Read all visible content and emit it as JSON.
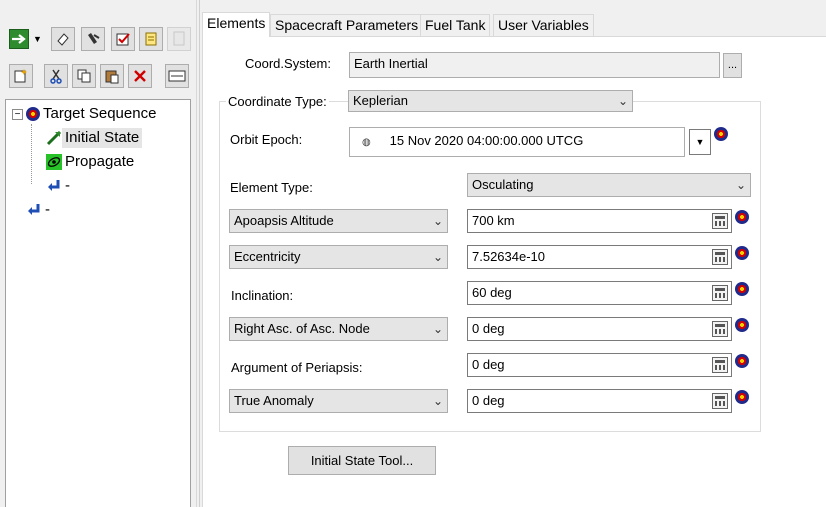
{
  "tree": {
    "items": [
      {
        "label": "Target Sequence",
        "icon": "target-sequence-icon"
      },
      {
        "label": "Initial State",
        "icon": "initial-state-icon"
      },
      {
        "label": "Propagate",
        "icon": "propagate-icon"
      },
      {
        "label": "-",
        "icon": "return-arrow-icon"
      },
      {
        "label": "-",
        "icon": "return-arrow-icon"
      }
    ]
  },
  "tabs": [
    "Elements",
    "Spacecraft Parameters",
    "Fuel Tank",
    "User Variables"
  ],
  "coord_system": {
    "label": "Coord.System:",
    "value": "Earth Inertial",
    "browse_label": "..."
  },
  "coordinate_type": {
    "label": "Coordinate Type:",
    "value": "Keplerian"
  },
  "orbit_epoch": {
    "label": "Orbit Epoch:",
    "value": "15 Nov 2020 04:00:00.000 UTCG"
  },
  "element_type": {
    "label": "Element Type:",
    "value": "Osculating"
  },
  "elements": [
    {
      "label": "Apoapsis Altitude",
      "value": "700 km",
      "dropdown": true
    },
    {
      "label": "Eccentricity",
      "value": "7.52634e-10",
      "dropdown": true
    },
    {
      "label": "Inclination:",
      "value": "60 deg",
      "dropdown": false
    },
    {
      "label": "Right Asc. of Asc. Node",
      "value": "0 deg",
      "dropdown": true
    },
    {
      "label": "Argument of Periapsis:",
      "value": "0 deg",
      "dropdown": false
    },
    {
      "label": "True Anomaly",
      "value": "0 deg",
      "dropdown": true
    }
  ],
  "initial_state_tool_label": "Initial State Tool..."
}
